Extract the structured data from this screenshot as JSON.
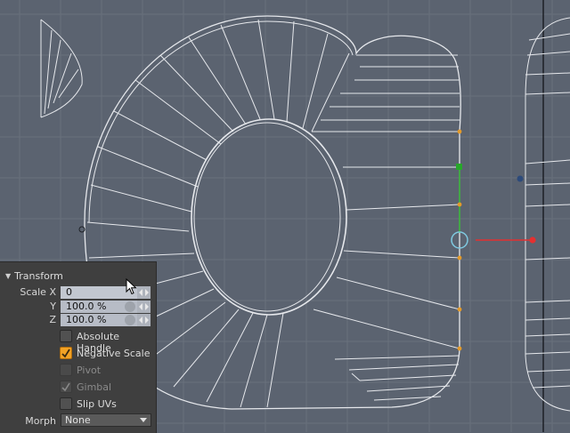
{
  "colors": {
    "viewport_bg": "#5b6370",
    "grid": "#6a727e",
    "wire": "#e6e8ec",
    "x_axis": "#e53030",
    "y_axis": "#2fae2f",
    "vertex": "#e39a2a",
    "panel_bg": "#3f3f3f",
    "checkbox_on": "#f2a225"
  },
  "panel": {
    "title": "Transform",
    "scale": {
      "x_label": "Scale X",
      "x_value": "0",
      "y_label": "Y",
      "y_value": "100.0 %",
      "z_label": "Z",
      "z_value": "100.0 %"
    },
    "options": [
      {
        "label": "Absolute Handle",
        "checked": false,
        "enabled": true
      },
      {
        "label": "Negative Scale",
        "checked": true,
        "enabled": true
      },
      {
        "label": "Pivot",
        "checked": false,
        "enabled": false
      },
      {
        "label": "Gimbal",
        "checked": true,
        "enabled": false
      },
      {
        "label": "Slip UVs",
        "checked": false,
        "enabled": true
      }
    ],
    "morph_label": "Morph",
    "morph_value": "None"
  }
}
